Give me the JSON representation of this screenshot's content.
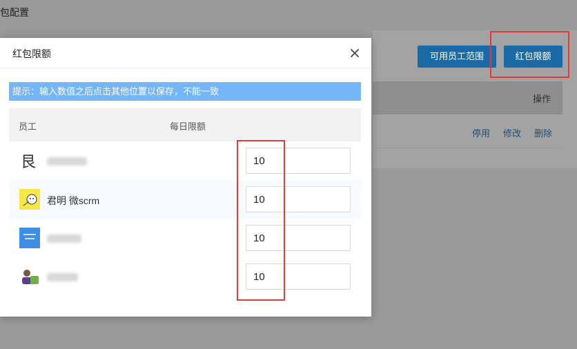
{
  "page": {
    "title": "包配置"
  },
  "background": {
    "buttons": {
      "range": "可用员工范围",
      "limit": "红包限额"
    },
    "table": {
      "op_header": "操作"
    },
    "row_actions": {
      "disable": "停用",
      "edit": "修改",
      "delete": "删除"
    }
  },
  "modal": {
    "title": "红包限额",
    "hint": "提示：输入数值之后点击其他位置以保存，不能一致",
    "columns": {
      "employee": "员工",
      "daily_limit": "每日限额"
    },
    "rows": [
      {
        "name": "",
        "limit": "10"
      },
      {
        "name": "君明 微scrm",
        "limit": "10"
      },
      {
        "name": "",
        "limit": "10"
      },
      {
        "name": "",
        "limit": "10"
      }
    ]
  },
  "colors": {
    "accent": "#1a6aa8",
    "hint_bg": "#75b6f8",
    "highlight": "#e53935"
  }
}
